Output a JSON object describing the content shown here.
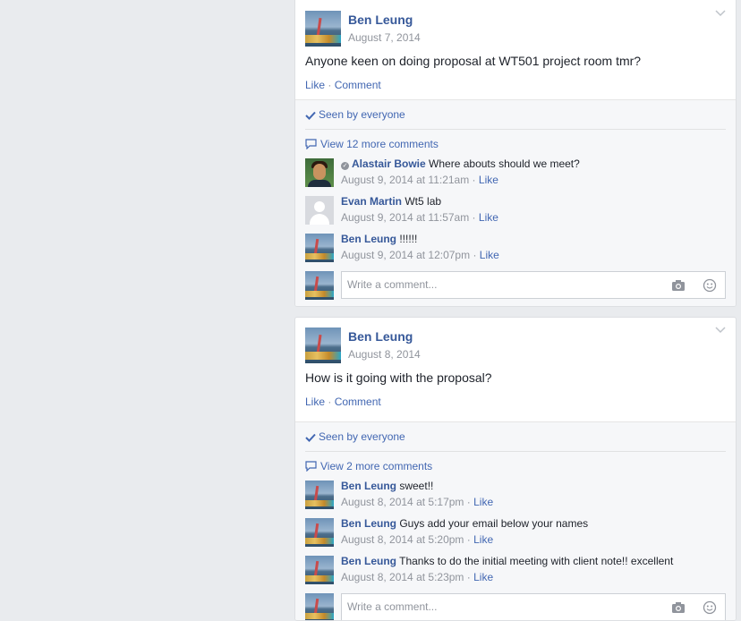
{
  "posts": [
    {
      "author": "Ben Leung",
      "date": "August 7, 2014",
      "text": "Anyone keen on doing proposal at WT501 project room tmr?",
      "like_label": "Like",
      "separator": " · ",
      "comment_label": "Comment",
      "seen_label": "Seen by everyone",
      "view_more_label": "View 12 more comments",
      "comments": [
        {
          "author": "Alastair Bowie",
          "text": "Where abouts should we meet?",
          "time": "August 9, 2014 at 11:21am",
          "like": "Like"
        },
        {
          "author": "Evan Martin",
          "text": "Wt5 lab",
          "time": "August 9, 2014 at 11:57am",
          "like": "Like"
        },
        {
          "author": "Ben Leung",
          "text": "!!!!!!",
          "time": "August 9, 2014 at 12:07pm",
          "like": "Like"
        }
      ],
      "write_placeholder": "Write a comment..."
    },
    {
      "author": "Ben Leung",
      "date": "August 8, 2014",
      "text": "How is it going with the proposal?",
      "like_label": "Like",
      "separator": " · ",
      "comment_label": "Comment",
      "seen_label": "Seen by everyone",
      "view_more_label": "View 2 more comments",
      "comments": [
        {
          "author": "Ben Leung",
          "text": "sweet!!",
          "time": "August 8, 2014 at 5:17pm",
          "like": "Like"
        },
        {
          "author": "Ben Leung",
          "text": "Guys add your email below your names",
          "time": "August 8, 2014 at 5:20pm",
          "like": "Like"
        },
        {
          "author": "Ben Leung",
          "text": "Thanks to do the initial meeting with client note!! excellent",
          "time": "August 8, 2014 at 5:23pm",
          "like": "Like"
        }
      ],
      "write_placeholder": "Write a comment..."
    }
  ],
  "comment_separator": " · ",
  "icons": {
    "post_menu": "chevron-down-icon",
    "seen": "checkmark-icon",
    "view_more": "speech-bubble-icon",
    "camera": "camera-icon",
    "emoji": "smiley-icon",
    "verified": "verified-badge-icon"
  },
  "colors": {
    "link": "#4267b2",
    "author": "#365899",
    "meta": "#90949c",
    "background": "#e9ebee"
  }
}
